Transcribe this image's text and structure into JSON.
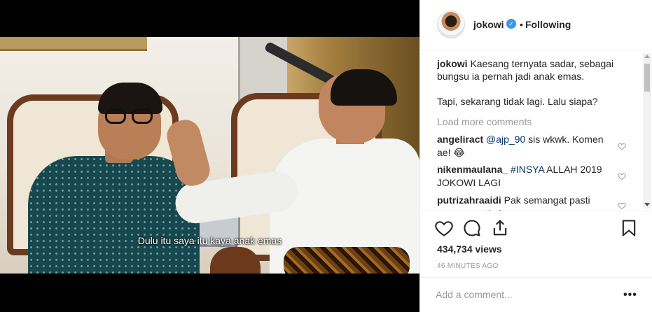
{
  "video": {
    "subtitle": "Dulu itu saya itu kaya anak emas"
  },
  "header": {
    "username": "jokowi",
    "verified_mark": "✓",
    "separator": "•",
    "follow_state": "Following"
  },
  "caption": {
    "username": "jokowi",
    "line1": "Kaesang ternyata sadar, sebagai bungsu ia pernah jadi anak emas.",
    "line2": "Tapi, sekarang tidak lagi. Lalu siapa?"
  },
  "load_more": "Load more comments",
  "comments": [
    {
      "username": "angeliract",
      "mention": "@ajp_90",
      "text": " sis wkwk. Komen ae! 😂"
    },
    {
      "username": "nikenmaulana_",
      "mention": "#INSYA",
      "text": " ALLAH 2019 JOKOWI LAGI"
    },
    {
      "username": "putrizahraaidi",
      "mention": "",
      "text": " Pak semangat pasti menang optimis"
    }
  ],
  "stats": {
    "views": "434,734 views",
    "time_ago": "46 MINUTES AGO"
  },
  "add_comment": {
    "placeholder": "Add a comment...",
    "more_label": "•••"
  },
  "colors": {
    "verified": "#3897f0",
    "mention": "#003569",
    "muted": "#999999",
    "text": "#262626"
  },
  "icons": [
    "heart-icon",
    "comment-icon",
    "share-icon",
    "bookmark-icon",
    "verified-badge-icon"
  ]
}
